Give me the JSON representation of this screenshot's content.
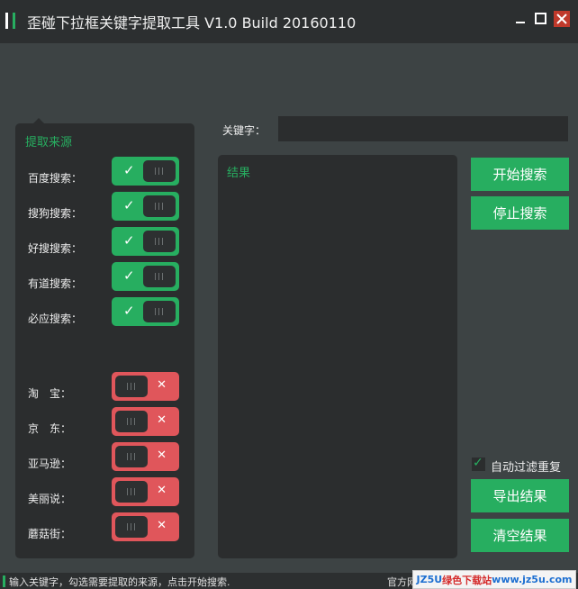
{
  "window": {
    "title": "歪碰下拉框关键字提取工具 V1.0 Build 20160110"
  },
  "source_panel": {
    "title": "提取来源",
    "sources": [
      {
        "label": "百度搜索：",
        "state": "on"
      },
      {
        "label": "搜狗搜索：",
        "state": "on"
      },
      {
        "label": "好搜搜索：",
        "state": "on"
      },
      {
        "label": "有道搜索：",
        "state": "on"
      },
      {
        "label": "必应搜索：",
        "state": "on"
      },
      {
        "label": "淘　宝：",
        "state": "off"
      },
      {
        "label": "京　东：",
        "state": "off"
      },
      {
        "label": "亚马逊：",
        "state": "off"
      },
      {
        "label": "美丽说：",
        "state": "off"
      },
      {
        "label": "蘑菇街：",
        "state": "off"
      }
    ],
    "on_mark": "✓",
    "off_mark": "✕"
  },
  "keyword": {
    "label": "关键字：",
    "value": "",
    "placeholder": ""
  },
  "results": {
    "title": "结果"
  },
  "buttons": {
    "start": "开始搜索",
    "stop": "停止搜索",
    "export": "导出结果",
    "clear": "清空结果"
  },
  "auto_filter": {
    "label": "自动过滤重复",
    "checked": true
  },
  "status": {
    "left": "输入关键字，勾选需要提取的来源，点击开始搜索.",
    "right": "官方网站"
  },
  "watermark": {
    "brand": "JZ5U",
    "cn": "绿色下载站",
    "url": "www.jz5u.com"
  },
  "colors": {
    "accent_green": "#27ae60",
    "off_red": "#e0565b",
    "panel": "#2b2d2e",
    "background": "#3d4344",
    "close_button": "#c0392b"
  }
}
